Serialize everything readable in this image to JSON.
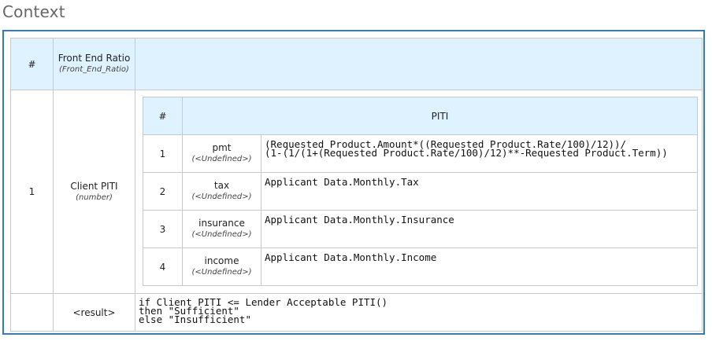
{
  "title": "Context",
  "outer_header": {
    "index": "#",
    "column_name": "Front End Ratio",
    "column_type": "(Front_End_Ratio)"
  },
  "entry": {
    "index": "1",
    "name": "Client PITI",
    "type": "(number)"
  },
  "inner": {
    "header_index": "#",
    "header_name": "PITI",
    "rows": [
      {
        "index": "1",
        "name": "pmt",
        "type": "(<Undefined>)",
        "expr": "(Requested Product.Amount*((Requested Product.Rate/100)/12))/\n(1-(1/(1+(Requested Product.Rate/100)/12)**-Requested Product.Term))"
      },
      {
        "index": "2",
        "name": "tax",
        "type": "(<Undefined>)",
        "expr": "Applicant Data.Monthly.Tax"
      },
      {
        "index": "3",
        "name": "insurance",
        "type": "(<Undefined>)",
        "expr": "Applicant Data.Monthly.Insurance"
      },
      {
        "index": "4",
        "name": "income",
        "type": "(<Undefined>)",
        "expr": "Applicant Data.Monthly.Income"
      }
    ]
  },
  "result": {
    "label": "<result>",
    "expr": "if Client PITI <= Lender Acceptable PITI()\nthen \"Sufficient\"\nelse \"Insufficient\""
  },
  "colors": {
    "header_bg": "#def3ff",
    "frame_border": "#2f7fb5",
    "grid_line": "#c9c9c9"
  }
}
